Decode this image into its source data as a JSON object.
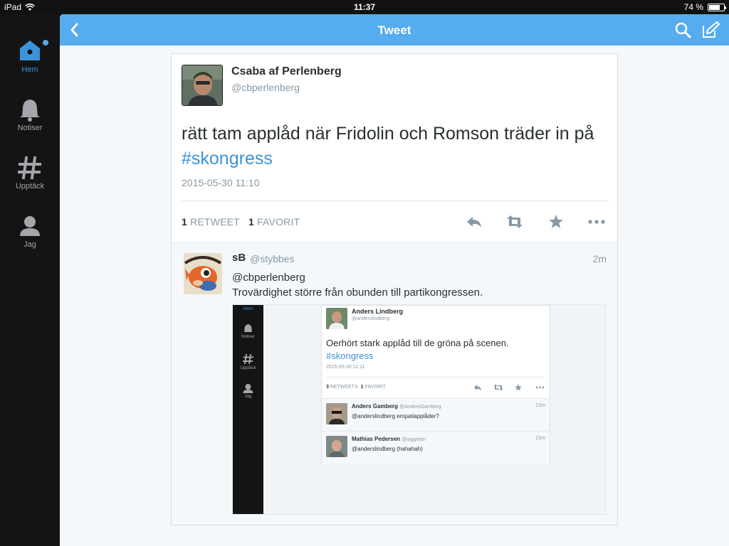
{
  "status_bar": {
    "device": "iPad",
    "time": "11:37",
    "battery": "74 %",
    "battery_level": 0.74
  },
  "sidebar": {
    "items": [
      {
        "label": "Hem",
        "icon": "home-icon",
        "active": true
      },
      {
        "label": "Notiser",
        "icon": "bell-icon",
        "active": false
      },
      {
        "label": "Upptäck",
        "icon": "hashtag-icon",
        "active": false
      },
      {
        "label": "Jag",
        "icon": "person-icon",
        "active": false
      }
    ]
  },
  "navbar": {
    "title": "Tweet",
    "back_icon": "chevron-left-icon",
    "search_icon": "search-icon",
    "compose_icon": "compose-icon"
  },
  "colors": {
    "accent": "#55acee",
    "link": "#3b94d9",
    "muted": "#8899a6",
    "text": "#292f33",
    "sidebar": "#141414"
  },
  "tweet": {
    "author_name": "Csaba af Perlenberg",
    "author_handle": "@cbperlenberg",
    "text": "rätt tam applåd när Fridolin och Romson träder in på ",
    "hashtag": "#skongress",
    "timestamp": "2015-05-30 11:10",
    "retweet_count": "1",
    "retweet_label": "RETWEET",
    "favorite_count": "1",
    "favorite_label": "FAVORIT",
    "actions": [
      "reply-icon",
      "retweet-icon",
      "favorite-icon",
      "more-icon"
    ]
  },
  "reply": {
    "author_name": "sB",
    "author_handle": "@stybbes",
    "time": "2m",
    "mention": "@cbperlenberg",
    "text": "Trovärdighet större från obunden till partikongressen.",
    "embedded_screenshot": {
      "sidebar_items": [
        "Hem",
        "Notiser",
        "Upptäck",
        "Jag"
      ],
      "tweet": {
        "author_name": "Anders Lindberg",
        "author_handle": "@anderslindberg",
        "text": "Oerhört stark applåd till de gröna på scenen.",
        "hashtag": "#skongress",
        "timestamp": "2015-05-30 11:11",
        "retweet_count": "3",
        "retweet_label": "RETWEETS",
        "favorite_count": "1",
        "favorite_label": "FAVORIT"
      },
      "replies": [
        {
          "author_name": "Anders Gamberg",
          "author_handle": "@AndersGamberg",
          "time": "21m",
          "text": "@anderslindberg empatiapplåder?"
        },
        {
          "author_name": "Mathias Pedersen",
          "author_handle": "@siggeton",
          "time": "21m",
          "text": "@anderslindberg (hahahah)"
        }
      ]
    }
  }
}
